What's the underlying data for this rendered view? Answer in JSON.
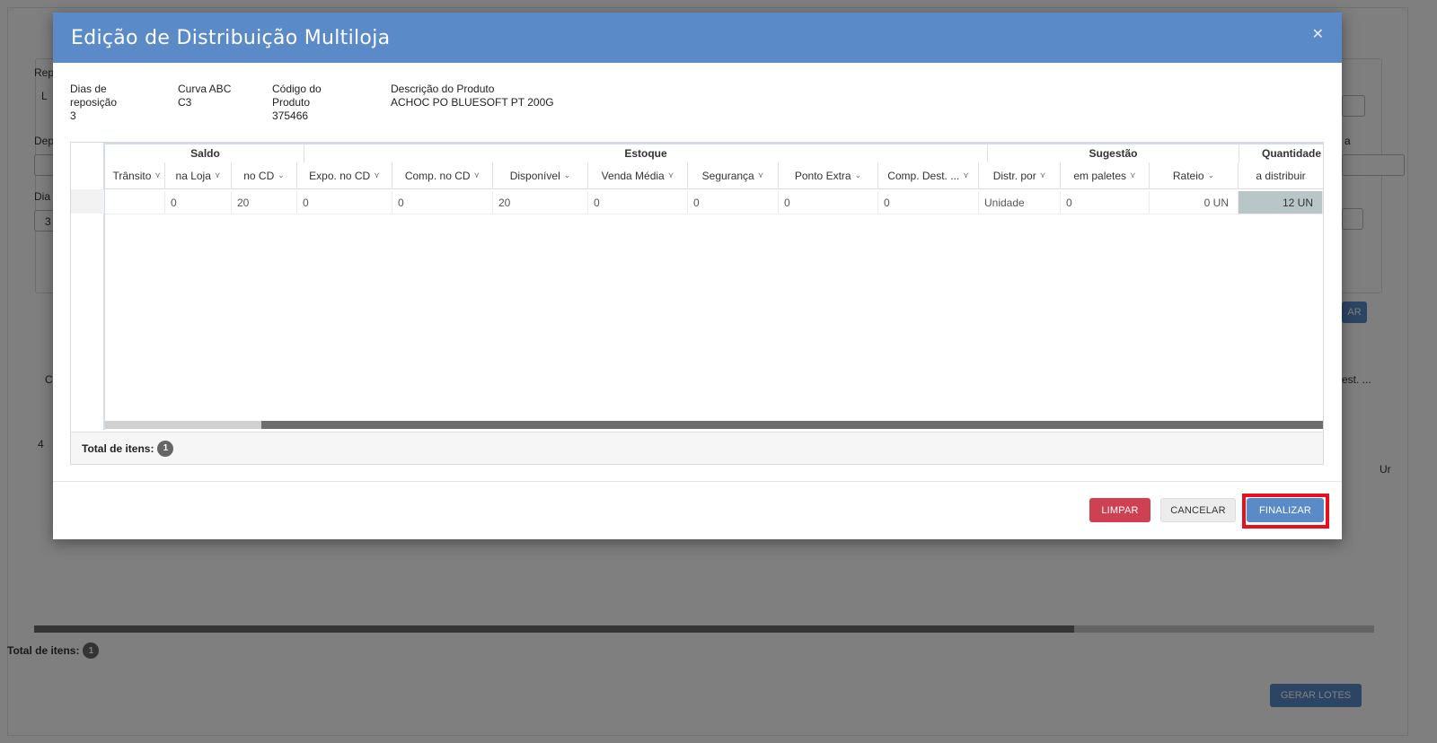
{
  "background": {
    "partial_labels": {
      "rep": "Rep",
      "dep": "Dep",
      "dia": "Dia",
      "a": "a",
      "l": "L",
      "t": "T",
      "three": "3",
      "c": "C",
      "four": "4",
      "est": "est. ...",
      "ur": "Ur"
    },
    "partial_button_label": "AR",
    "total_label": "Total de itens:",
    "total_count": "1",
    "gerar_lotes_label": "GERAR LOTES"
  },
  "modal": {
    "title": "Edição de Distribuição Multiloja",
    "close_icon": "close-icon",
    "info": {
      "dias_reposicao_label": "Dias de reposição",
      "dias_reposicao_value": "3",
      "curva_abc_label": "Curva ABC",
      "curva_abc_value": "C3",
      "codigo_produto_label": "Código do Produto",
      "codigo_produto_value": "375466",
      "descricao_label": "Descrição do Produto",
      "descricao_value": "ACHOC PO BLUESOFT PT 200G"
    },
    "grid": {
      "groups": {
        "saldo": "Saldo",
        "estoque": "Estoque",
        "sugestao": "Sugestão",
        "quantidade": "Quantidade"
      },
      "columns": [
        "Trânsito",
        "na Loja",
        "no CD",
        "Expo. no CD",
        "Comp. no CD",
        "Disponível",
        "Venda Média",
        "Segurança",
        "Ponto Extra",
        "Comp. Dest. ...",
        "Distr. por",
        "em paletes",
        "Rateio",
        "a distribuir"
      ],
      "row": [
        "",
        "0",
        "20",
        "0",
        "0",
        "20",
        "0",
        "0",
        "0",
        "0",
        "Unidade",
        "0",
        "0 UN",
        "12 UN"
      ],
      "total_label": "Total de itens:",
      "total_count": "1"
    },
    "buttons": {
      "limpar": "LIMPAR",
      "cancelar": "CANCELAR",
      "finalizar": "FINALIZAR"
    }
  }
}
